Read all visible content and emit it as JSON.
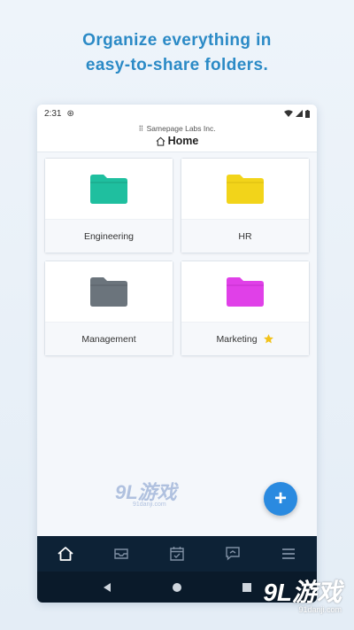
{
  "headline": {
    "line1": "Organize everything in",
    "line2": "easy-to-share folders."
  },
  "status": {
    "time": "2:31"
  },
  "header": {
    "org": "Samepage Labs Inc.",
    "title": "Home"
  },
  "folders": [
    {
      "name": "Engineering",
      "color": "#1fbf9f",
      "starred": false
    },
    {
      "name": "HR",
      "color": "#f2d41a",
      "starred": false
    },
    {
      "name": "Management",
      "color": "#6b747c",
      "starred": false
    },
    {
      "name": "Marketing",
      "color": "#e040e8",
      "starred": true
    }
  ],
  "fab": {
    "label": "+"
  },
  "tabs": [
    "home-icon",
    "inbox-icon",
    "calendar-icon",
    "chat-icon",
    "menu-icon"
  ],
  "colors": {
    "accent": "#2a8ae0",
    "tabbar": "#0d2236",
    "headline": "#2b8ac6",
    "star": "#f2c21a"
  },
  "watermark": {
    "main": "9L游戏",
    "sub": "91danji.com"
  },
  "badge": {
    "main": "9L游戏",
    "sub": "91danji.com"
  }
}
